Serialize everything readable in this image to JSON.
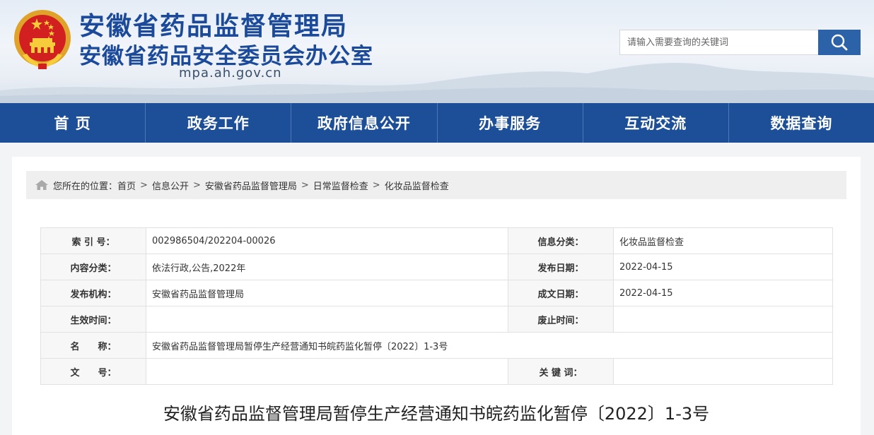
{
  "header": {
    "title": "安徽省药品监督管理局",
    "subtitle": "安徽省药品安全委员会办公室",
    "domain": "mpa.ah.gov.cn",
    "emblem_icon": "national-emblem-icon"
  },
  "search": {
    "placeholder": "请输入需要查询的关键词",
    "button_icon": "search-icon"
  },
  "nav": [
    "首 页",
    "政务工作",
    "政府信息公开",
    "办事服务",
    "互动交流",
    "数据查询"
  ],
  "breadcrumb": {
    "prefix": "您所在的位置：",
    "items": [
      "首页",
      "信息公开",
      "安徽省药品监督管理局",
      "日常监督检查",
      "化妆品监督检查"
    ],
    "separator": ">"
  },
  "meta": {
    "index_no_label": "索 引 号：",
    "index_no": "002986504/202204-00026",
    "info_category_label": "信息分类：",
    "info_category": "化妆品监督检查",
    "content_category_label": "内容分类：",
    "content_category": "依法行政,公告,2022年",
    "publish_date_label": "发布日期：",
    "publish_date": "2022-04-15",
    "publisher_label": "发布机构：",
    "publisher": "安徽省药品监督管理局",
    "written_date_label": "成文日期：",
    "written_date": "2022-04-15",
    "effective_label": "生效时间：",
    "effective": "",
    "expired_label": "废止时间：",
    "expired": "",
    "name_label": "名　　称：",
    "name": "安徽省药品监督管理局暂停生产经营通知书皖药监化暂停〔2022〕1-3号",
    "doc_no_label": "文　　号：",
    "doc_no": "",
    "keywords_label": "关 键 词：",
    "keywords": ""
  },
  "document": {
    "title": "安徽省药品监督管理局暂停生产经营通知书皖药监化暂停〔2022〕1-3号"
  },
  "colors": {
    "nav_bg": "#1d4f98",
    "title_blue": "#1c4a9a",
    "search_button": "#2b62a8",
    "breadcrumb_bg": "#efefef"
  }
}
